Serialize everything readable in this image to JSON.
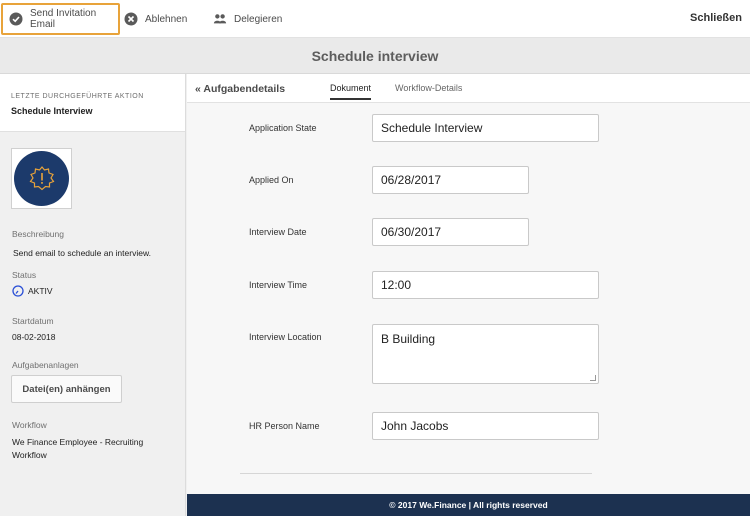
{
  "toolbar": {
    "send_label": "Send Invitation Email",
    "reject_label": "Ablehnen",
    "delegate_label": "Delegieren",
    "close_label": "Schließen"
  },
  "title": "Schedule interview",
  "sidebar": {
    "last_action_label": "LETZTE DURCHGEFÜHRTE AKTION",
    "last_action_value": "Schedule Interview",
    "description_label": "Beschreibung",
    "description_value": "Send email to schedule an interview.",
    "status_label": "Status",
    "status_value": "AKTIV",
    "start_date_label": "Startdatum",
    "start_date_value": "08-02-2018",
    "attachments_label": "Aufgabenanlagen",
    "attach_button_label": "Datei(en) anhängen",
    "workflow_label": "Workflow",
    "workflow_value": "We Finance Employee - Recruiting Workflow"
  },
  "tabs": {
    "back_label": "Aufgabendetails",
    "document": "Dokument",
    "workflow_details": "Workflow-Details"
  },
  "form": {
    "application_state": {
      "label": "Application State",
      "value": "Schedule Interview"
    },
    "applied_on": {
      "label": "Applied On",
      "value": "06/28/2017"
    },
    "interview_date": {
      "label": "Interview Date",
      "value": "06/30/2017"
    },
    "interview_time": {
      "label": "Interview Time",
      "value": "12:00"
    },
    "interview_location": {
      "label": "Interview Location",
      "value": "B Building"
    },
    "hr_person_name": {
      "label": "HR Person Name",
      "value": "John Jacobs"
    }
  },
  "footer": "© 2017 We.Finance | All rights reserved",
  "colors": {
    "accent_border": "#e8a33a",
    "footer_bg": "#1c3150",
    "icon_bg": "#1c3a6b",
    "status_blue": "#2a4fd6"
  },
  "icons": {
    "send": "check-circle-icon",
    "reject": "x-circle-icon",
    "delegate": "users-icon",
    "back": "double-chevron-left-icon",
    "task": "alert-gear-icon",
    "status": "clock-icon"
  }
}
